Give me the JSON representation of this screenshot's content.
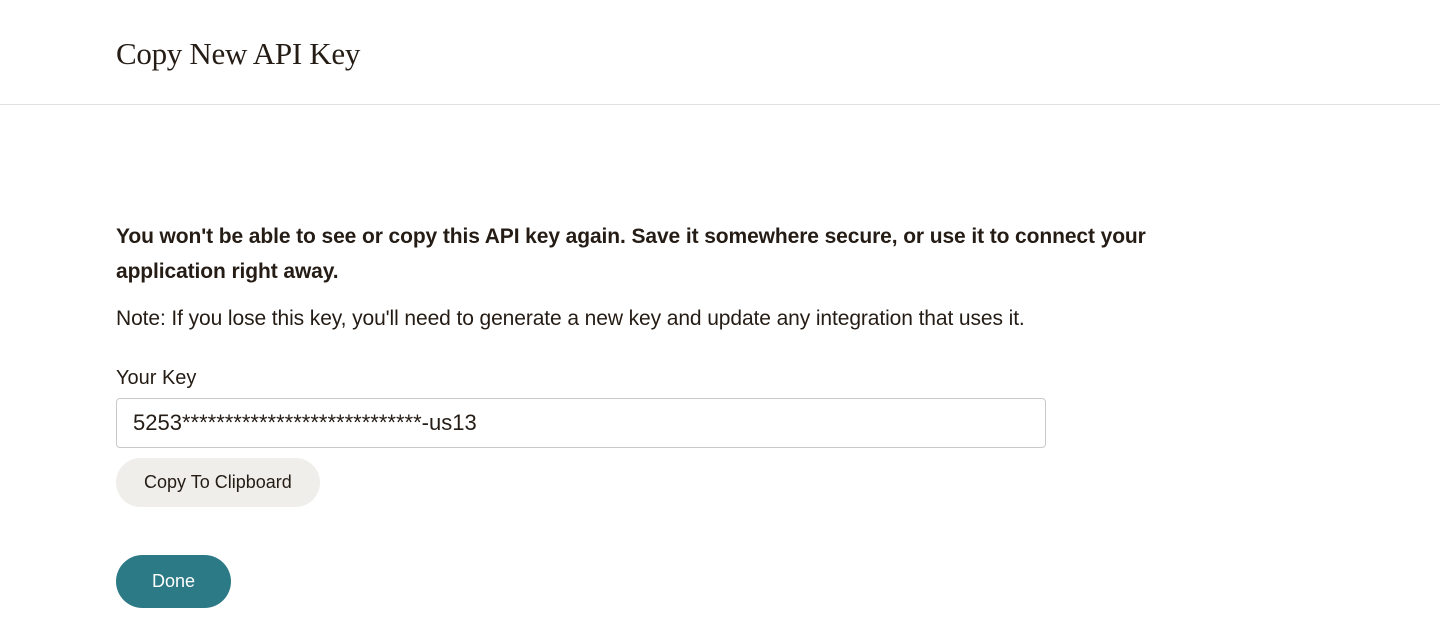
{
  "header": {
    "title": "Copy New API Key"
  },
  "content": {
    "warning": "You won't be able to see or copy this API key again. Save it somewhere secure, or use it to connect your application right away.",
    "note": "Note: If you lose this key, you'll need to generate a new key and update any integration that uses it.",
    "key_label": "Your Key",
    "key_value": "5253****************************-us13",
    "copy_button_label": "Copy To Clipboard",
    "done_button_label": "Done"
  }
}
